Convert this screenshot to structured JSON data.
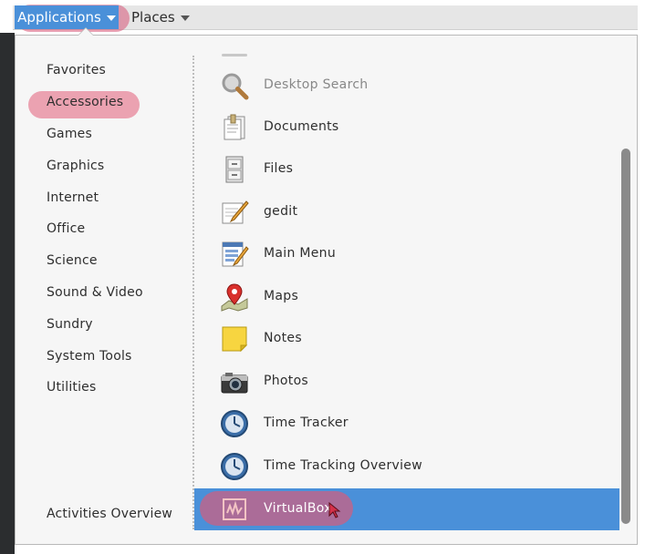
{
  "topbar": {
    "applications_label": "Applications",
    "places_label": "Places"
  },
  "categories": [
    {
      "label": "Favorites"
    },
    {
      "label": "Accessories",
      "highlighted": true
    },
    {
      "label": "Games"
    },
    {
      "label": "Graphics"
    },
    {
      "label": "Internet"
    },
    {
      "label": "Office"
    },
    {
      "label": "Science"
    },
    {
      "label": "Sound & Video"
    },
    {
      "label": "Sundry"
    },
    {
      "label": "System Tools"
    },
    {
      "label": "Utilities"
    }
  ],
  "activities_label": "Activities Overview",
  "apps": [
    {
      "label": "Desktop Search",
      "icon": "magnifier-icon"
    },
    {
      "label": "Documents",
      "icon": "documents-icon"
    },
    {
      "label": "Files",
      "icon": "file-cabinet-icon"
    },
    {
      "label": "gedit",
      "icon": "text-editor-icon"
    },
    {
      "label": "Main Menu",
      "icon": "menu-editor-icon"
    },
    {
      "label": "Maps",
      "icon": "map-pin-icon"
    },
    {
      "label": "Notes",
      "icon": "sticky-note-icon"
    },
    {
      "label": "Photos",
      "icon": "camera-icon"
    },
    {
      "label": "Time Tracker",
      "icon": "time-tracker-icon"
    },
    {
      "label": "Time Tracking Overview",
      "icon": "time-tracker-icon"
    },
    {
      "label": "VirtualBox",
      "icon": "virtualbox-icon",
      "selected": true
    }
  ],
  "colors": {
    "selection_blue": "#4a90d9",
    "highlight_pink": "#e25c78"
  }
}
